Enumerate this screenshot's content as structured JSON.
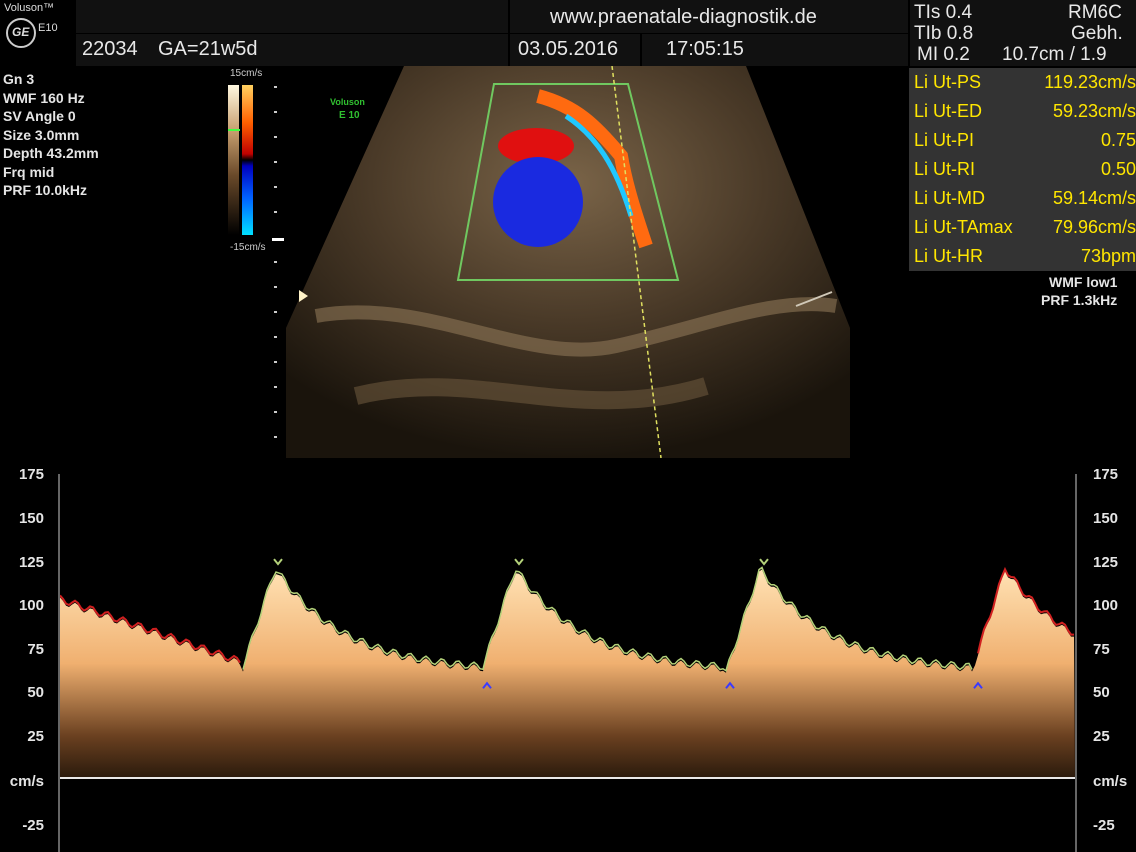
{
  "brand": {
    "name": "Voluson™",
    "model": "E10",
    "logo": "GE",
    "watermark_name": "Voluson",
    "watermark_model": "E 10"
  },
  "header": {
    "patient_id": "22034",
    "gestational_age": "GA=21w5d",
    "website": "www.praenatale-diagnostik.de",
    "date": "03.05.2016",
    "time": "17:05:15",
    "tis": "TIs  0.4",
    "tib": "TIb  0.8",
    "mi": "MI  0.2",
    "probe": "RM6C",
    "preset": "Gebh.",
    "depth_fr": "10.7cm / 1.9"
  },
  "settings": [
    "Gn  3",
    "WMF 160 Hz",
    "SV Angle  0",
    "Size  3.0mm",
    "Depth 43.2mm",
    "Frq mid",
    "PRF 10.0kHz"
  ],
  "color_scale": {
    "top": "15cm/s",
    "bottom": "-15cm/s"
  },
  "doppler_settings": {
    "wmf": "WMF low1",
    "prf": "PRF  1.3kHz"
  },
  "measurements": [
    {
      "label": "Li Ut-PS",
      "value": "119.23cm/s"
    },
    {
      "label": "Li Ut-ED",
      "value": "59.23cm/s"
    },
    {
      "label": "Li Ut-PI",
      "value": "0.75"
    },
    {
      "label": "Li Ut-RI",
      "value": "0.50"
    },
    {
      "label": "Li Ut-MD",
      "value": "59.14cm/s"
    },
    {
      "label": "Li Ut-TAmax",
      "value": "79.96cm/s"
    },
    {
      "label": "Li Ut-HR",
      "value": "73bpm"
    }
  ],
  "spectral": {
    "unit": "cm/s",
    "ticks": [
      "175",
      "150",
      "125",
      "100",
      "75",
      "50",
      "25",
      "-25"
    ],
    "colors": {
      "trace": "#b4d27a",
      "trace_edge": "#d02020",
      "marker": "#3a3aff",
      "bright": "#ffe8c0"
    }
  }
}
